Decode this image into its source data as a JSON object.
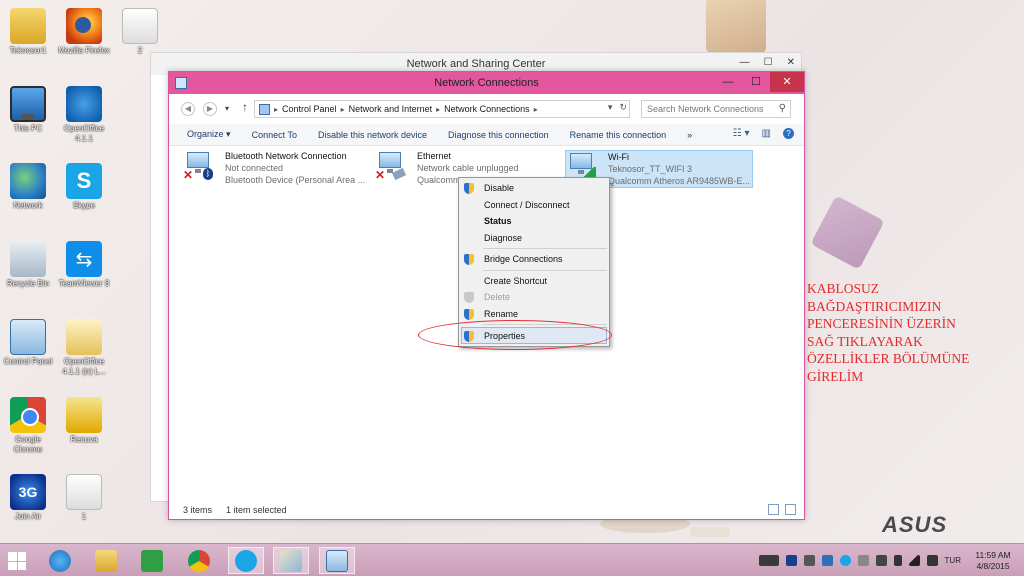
{
  "desktop": {
    "icons": [
      {
        "label": "Teknosor1",
        "icon": "folder-icon"
      },
      {
        "label": "Mozilla Firefox",
        "icon": "firefox-icon"
      },
      {
        "label": "2",
        "icon": "file-icon"
      },
      {
        "label": "This PC",
        "icon": "this-pc-icon"
      },
      {
        "label": "OpenOffice 4.1.1",
        "icon": "openoffice-icon"
      },
      {
        "label": "Network",
        "icon": "network-icon"
      },
      {
        "label": "Skype",
        "icon": "skype-icon"
      },
      {
        "label": "Recycle Bin",
        "icon": "recycle-bin-icon"
      },
      {
        "label": "TeamViewer 8",
        "icon": "teamviewer-icon"
      },
      {
        "label": "Control Panel",
        "icon": "control-panel-icon"
      },
      {
        "label": "OpenOffice 4.1.1 (tr) L...",
        "icon": "folder-icon"
      },
      {
        "label": "Google Chrome",
        "icon": "chrome-icon"
      },
      {
        "label": "Recuva",
        "icon": "recuva-icon"
      },
      {
        "label": "Join Air",
        "icon": "join-air-icon"
      },
      {
        "label": "1",
        "icon": "file-icon"
      }
    ],
    "annotation": "KABLOSUZ\nBAĞDAŞTIRICIMIZIN\nPENCERESİNİN ÜZERİN\nSAĞ TIKLAYARAK\nÖZELLİKLER BÖLÜMÜNE\nGİRELİM",
    "brand": "ASUS",
    "annotation_color": "#e52b2b"
  },
  "back_window": {
    "title": "Network and Sharing Center"
  },
  "window": {
    "title": "Network Connections",
    "controls": {
      "minimize": "—",
      "maximize": "☐",
      "close": "✕"
    },
    "address": {
      "breadcrumbs": [
        "Control Panel",
        "Network and Internet",
        "Network Connections"
      ],
      "search_placeholder": "Search Network Connections"
    },
    "toolbar": {
      "organize": "Organize",
      "connect_to": "Connect To",
      "disable_device": "Disable this network device",
      "diagnose": "Diagnose this connection",
      "rename": "Rename this connection",
      "more": "»"
    },
    "connections": [
      {
        "name": "Bluetooth Network Connection",
        "status": "Not connected",
        "device": "Bluetooth Device (Personal Area ..."
      },
      {
        "name": "Ethernet",
        "status": "Network cable unplugged",
        "device": "Qualcomm"
      },
      {
        "name": "Wi-Fi",
        "status": "Teknosor_TT_WIFI  3",
        "device": "Qualcomm Atheros AR9485WB-E..."
      }
    ],
    "status": {
      "items": "3 items",
      "selected": "1 item selected"
    },
    "accent": "#e3579f"
  },
  "context_menu": {
    "items": [
      {
        "label": "Disable"
      },
      {
        "label": "Connect / Disconnect"
      },
      {
        "label": "Status"
      },
      {
        "label": "Diagnose"
      },
      {
        "label": "Bridge Connections"
      },
      {
        "label": "Create Shortcut"
      },
      {
        "label": "Delete"
      },
      {
        "label": "Rename"
      },
      {
        "label": "Properties"
      }
    ]
  },
  "taskbar": {
    "apps": [
      "internet-explorer-icon",
      "file-explorer-icon",
      "store-icon",
      "chrome-icon",
      "skype-icon",
      "paint-icon",
      "control-panel-icon"
    ],
    "language": "TUR",
    "time": "11:59 AM",
    "date": "4/8/2015"
  }
}
